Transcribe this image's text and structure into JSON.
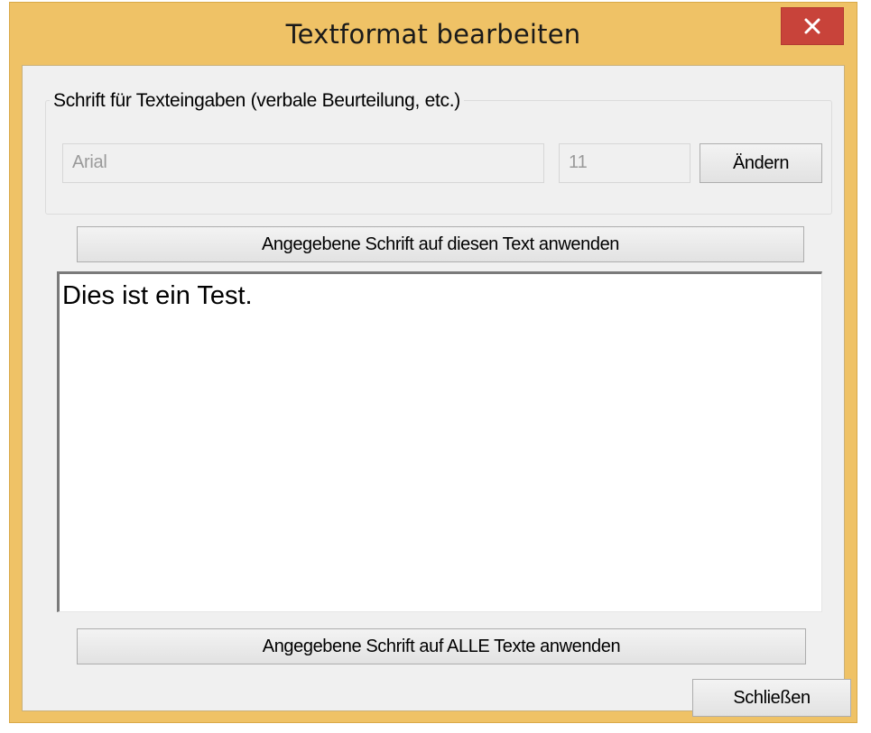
{
  "window": {
    "title": "Textformat bearbeiten",
    "titlebar_color": "#efc266",
    "close_icon": "close-icon",
    "close_color": "#c8433a"
  },
  "font_group": {
    "legend": "Schrift für Texteingaben (verbale Beurteilung, etc.)",
    "font_name": "Arial",
    "font_size": "11",
    "change_label": "Ändern"
  },
  "buttons": {
    "apply_this_label": "Angegebene Schrift auf diesen Text anwenden",
    "apply_all_label": "Angegebene Schrift auf ALLE Texte anwenden",
    "close_label": "Schließen"
  },
  "preview": {
    "text": "Dies ist ein Test."
  }
}
